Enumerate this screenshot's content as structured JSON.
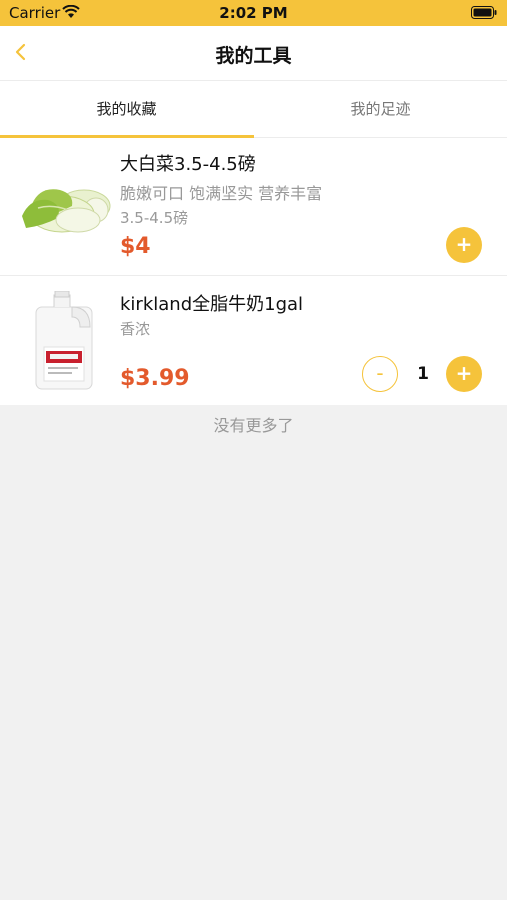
{
  "status_bar": {
    "carrier": "Carrier",
    "time": "2:02 PM"
  },
  "nav": {
    "title": "我的工具"
  },
  "tabs": [
    {
      "label": "我的收藏",
      "active": true
    },
    {
      "label": "我的足迹",
      "active": false
    }
  ],
  "items": [
    {
      "name": "大白菜3.5-4.5磅",
      "desc_lines": [
        "脆嫩可口 饱满坚实 营养丰富",
        "3.5-4.5磅"
      ],
      "price": "$4",
      "image": "napa-cabbage"
    },
    {
      "name": "kirkland全脂牛奶1gal",
      "desc_lines": [
        "香浓"
      ],
      "price": "$3.99",
      "quantity": "1",
      "image": "milk-gallon"
    }
  ],
  "buttons": {
    "plus": "+",
    "minus": "-"
  },
  "footer": {
    "no_more": "没有更多了"
  },
  "colors": {
    "accent": "#f5c33b",
    "price": "#e35a2c"
  }
}
